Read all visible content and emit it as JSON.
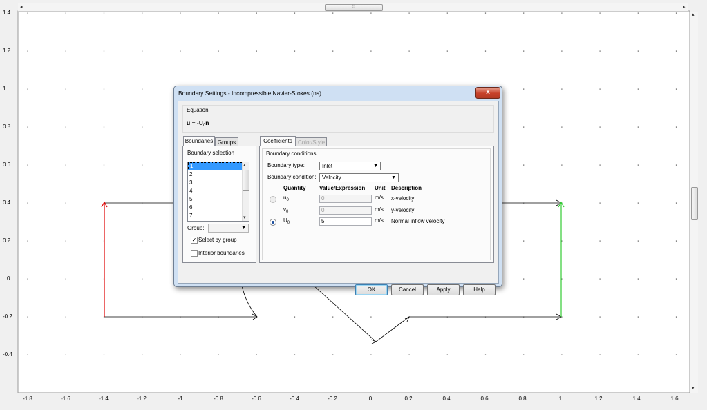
{
  "plot": {
    "y_ticks": [
      "1.4",
      "1.2",
      "1",
      "0.8",
      "0.6",
      "0.4",
      "0.2",
      "0",
      "-0.2",
      "-0.4"
    ],
    "x_ticks": [
      "-1.8",
      "-1.6",
      "-1.4",
      "-1.2",
      "-1",
      "-0.8",
      "-0.6",
      "-0.4",
      "-0.2",
      "0",
      "0.2",
      "0.4",
      "0.6",
      "0.8",
      "1",
      "1.2",
      "1.4",
      "1.6"
    ],
    "inlet_color": "#e00000",
    "outlet_color": "#33cc33"
  },
  "dialog": {
    "title": "Boundary Settings - Incompressible Navier-Stokes (ns)",
    "close_glyph": "x",
    "equation_label": "Equation",
    "equation_lhs": "u",
    "equation_mid": " = -U",
    "equation_sub": "0",
    "equation_rhs": "n",
    "left_tabs": [
      "Boundaries",
      "Groups"
    ],
    "boundary_selection_label": "Boundary selection",
    "boundary_items": [
      "1",
      "2",
      "3",
      "4",
      "5",
      "6",
      "7"
    ],
    "group_label": "Group:",
    "select_by_group": "Select by group",
    "select_by_group_checked": true,
    "interior_boundaries": "Interior boundaries",
    "right_tabs": [
      "Coefficients",
      "Color/Style"
    ],
    "bc_group_label": "Boundary conditions",
    "boundary_type_label": "Boundary type:",
    "boundary_type_value": "Inlet",
    "boundary_condition_label": "Boundary condition:",
    "boundary_condition_value": "Velocity",
    "headers": {
      "quantity": "Quantity",
      "value": "Value/Expression",
      "unit": "Unit",
      "description": "Description"
    },
    "rows": [
      {
        "q": "u",
        "sub": "0",
        "value": "0",
        "unit": "m/s",
        "desc": "x-velocity",
        "selected": false
      },
      {
        "q": "v",
        "sub": "0",
        "value": "0",
        "unit": "m/s",
        "desc": "y-velocity",
        "selected": false
      },
      {
        "q": "U",
        "sub": "0",
        "value": "5",
        "unit": "m/s",
        "desc": "Normal inflow velocity",
        "selected": true
      }
    ],
    "buttons": {
      "ok": "OK",
      "cancel": "Cancel",
      "apply": "Apply",
      "help": "Help"
    }
  }
}
